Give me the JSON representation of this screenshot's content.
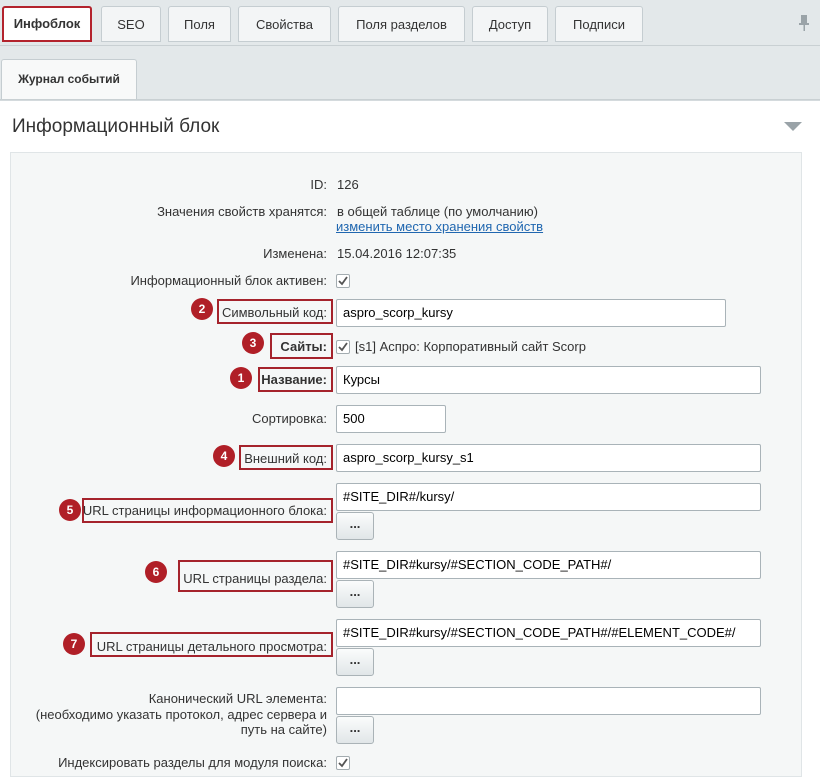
{
  "tabs": [
    "Инфоблок",
    "SEO",
    "Поля",
    "Свойства",
    "Поля разделов",
    "Доступ",
    "Подписи"
  ],
  "tab2": "Журнал событий",
  "panel_title": "Информационный блок",
  "fields": {
    "id_label": "ID:",
    "id_value": "126",
    "storage_label": "Значения свойств хранятся:",
    "storage_value": "в общей таблице (по умолчанию)",
    "storage_link": "изменить место хранения свойств",
    "changed_label": "Изменена:",
    "changed_value": "15.04.2016 12:07:35",
    "active_label": "Информационный блок активен:",
    "code_label": "Символьный код:",
    "code_value": "aspro_scorp_kursy",
    "sites_label": "Сайты:",
    "sites_value": "[s1] Аспро: Корпоративный сайт Scorp",
    "name_label": "Название:",
    "name_value": "Курсы",
    "sort_label": "Сортировка:",
    "sort_value": "500",
    "ext_label": "Внешний код:",
    "ext_value": "aspro_scorp_kursy_s1",
    "url_ib_label": "URL страницы информационного блока:",
    "url_ib_value": "#SITE_DIR#/kursy/",
    "url_sec_label": "URL страницы раздела:",
    "url_sec_value": "#SITE_DIR#kursy/#SECTION_CODE_PATH#/",
    "url_det_label": "URL страницы детального просмотра:",
    "url_det_value": "#SITE_DIR#kursy/#SECTION_CODE_PATH#/#ELEMENT_CODE#/",
    "canon_label_1": "Канонический URL элемента:",
    "canon_label_2": "(необходимо указать протокол, адрес сервера и",
    "canon_label_3": "путь на сайте)",
    "canon_value": "",
    "index_label": "Индексировать разделы для модуля поиска:"
  },
  "button_label": "...",
  "badges": [
    "2",
    "3",
    "1",
    "4",
    "5",
    "6",
    "7"
  ],
  "colors": {
    "highlight": "#a5232c",
    "badge": "#b01f27",
    "link": "#2067b0"
  }
}
